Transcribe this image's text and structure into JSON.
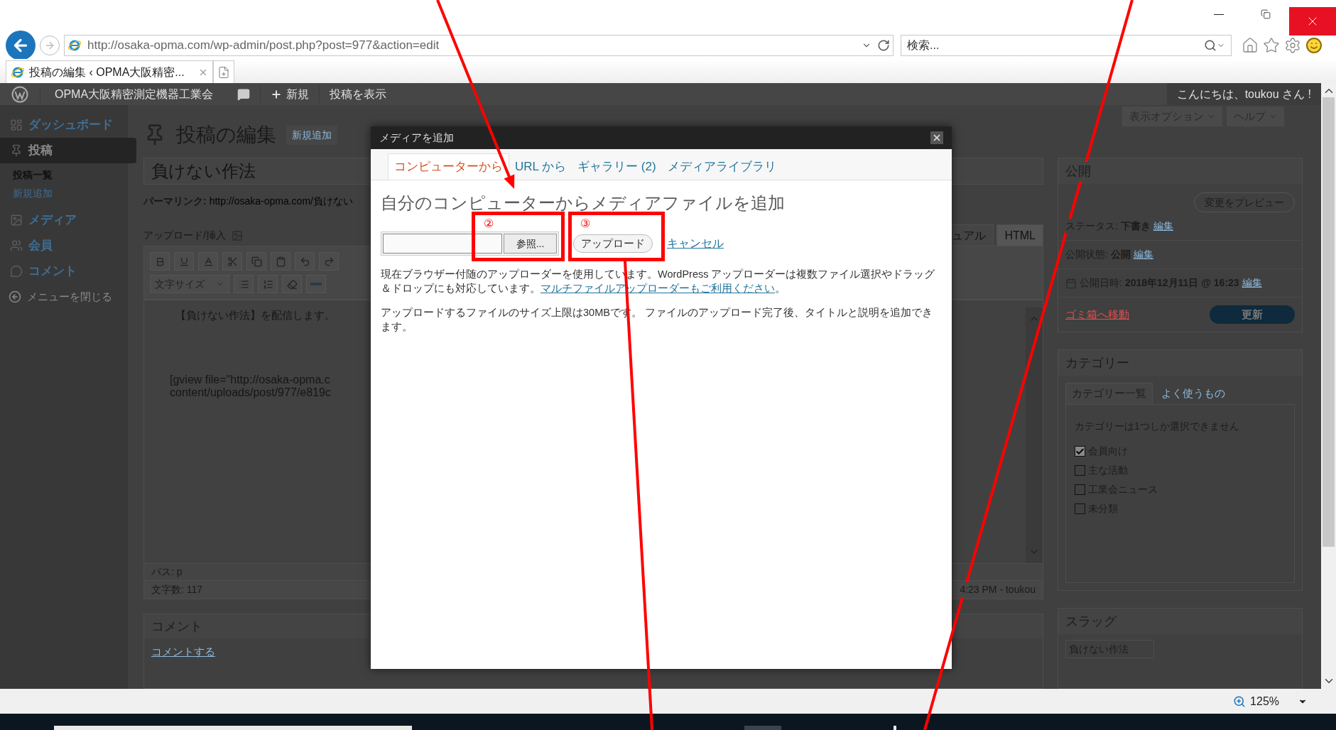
{
  "browser": {
    "address": "http://osaka-opma.com/wp-admin/post.php?post=977&action=edit",
    "search_placeholder": "検索...",
    "tabs": [
      {
        "title": "投稿の編集 ‹ OPMA大阪精密...",
        "selected": true
      }
    ],
    "zoom": "125%"
  },
  "admin_bar": {
    "site": "OPMA大阪精密測定機器工業会",
    "new": "新規",
    "view": "投稿を表示",
    "greeting": "こんにちは、toukou さん !"
  },
  "sidebar": {
    "items": [
      {
        "label": "ダッシュボード",
        "selected": false
      },
      {
        "label": "投稿",
        "selected": true,
        "children": [
          {
            "label": "投稿一覧",
            "selected": true
          },
          {
            "label": "新規追加",
            "selected": false
          }
        ]
      },
      {
        "label": "メディア",
        "selected": false
      },
      {
        "label": "会員",
        "selected": false
      },
      {
        "label": "コメント",
        "selected": false
      }
    ],
    "collapse": "メニューを閉じる"
  },
  "screen_options": "表示オプション",
  "help": "ヘルプ",
  "editor": {
    "heading": "投稿の編集",
    "add_new": "新規追加",
    "title": "負けない作法",
    "permalink_label": "パーマリンク:",
    "permalink": "http://osaka-opma.com/負けない",
    "upload_insert": "アップロード/挿入",
    "view_tabs": [
      {
        "label": "ュアル",
        "selected": true
      },
      {
        "label": "HTML",
        "selected": false
      }
    ],
    "font_size": "文字サイズ",
    "content": [
      "【負けない作法】を配信します。",
      "[gview file=\"http://osaka-opma.c",
      "content/uploads/post/977/e819c"
    ],
    "path": "パス: p",
    "word_count": "文字数: 117",
    "last_edited": "4:23 PM - toukou"
  },
  "comments": {
    "heading": "コメント",
    "add": "コメントする"
  },
  "publish": {
    "heading": "公開",
    "preview": "変更をプレビュー",
    "rows": [
      {
        "kind": "plain",
        "label": "ステータス:",
        "value": "下書き",
        "edit": "編集"
      },
      {
        "kind": "plain",
        "label": "公開状態:",
        "value": "公開",
        "edit": "編集"
      },
      {
        "kind": "date",
        "label": "公開日時:",
        "value": "2018年12月11日 @ 16:23",
        "edit": "編集"
      }
    ],
    "trash": "ゴミ箱へ移動",
    "update": "更新"
  },
  "categories": {
    "heading": "カテゴリー",
    "tabs": [
      {
        "label": "カテゴリー一覧",
        "selected": true
      },
      {
        "label": "よく使うもの",
        "selected": false
      }
    ],
    "note": "カテゴリーは1つしか選択できません",
    "items": [
      {
        "label": "会員向け",
        "checked": true
      },
      {
        "label": "主な活動",
        "checked": false
      },
      {
        "label": "工業会ニュース",
        "checked": false
      },
      {
        "label": "未分類",
        "checked": false
      }
    ]
  },
  "slug": {
    "heading": "スラッグ",
    "value": "負けない作法"
  },
  "modal": {
    "title": "メディアを追加",
    "tabs": [
      {
        "label": "コンピューターから",
        "selected": true
      },
      {
        "label": "URL から",
        "selected": false
      },
      {
        "label": "ギャラリー (2)",
        "selected": false
      },
      {
        "label": "メディアライブラリ",
        "selected": false
      }
    ],
    "heading": "自分のコンピューターからメディアファイルを追加",
    "browse": "参照...",
    "upload": "アップロード",
    "cancel": "キャンセル",
    "note": "現在ブラウザー付随のアップローダーを使用しています。WordPress アップローダーは複数ファイル選択やドラッグ＆ドロップにも対応しています。",
    "note_link": "マルチファイルアップローダーもご利用ください",
    "note_end": "。",
    "limit": "アップロードするファイルのサイズ上限は30MBです。 ファイルのアップロード完了後、タイトルと説明を追加できます。"
  },
  "annotations": {
    "markers": [
      "②",
      "③"
    ]
  }
}
